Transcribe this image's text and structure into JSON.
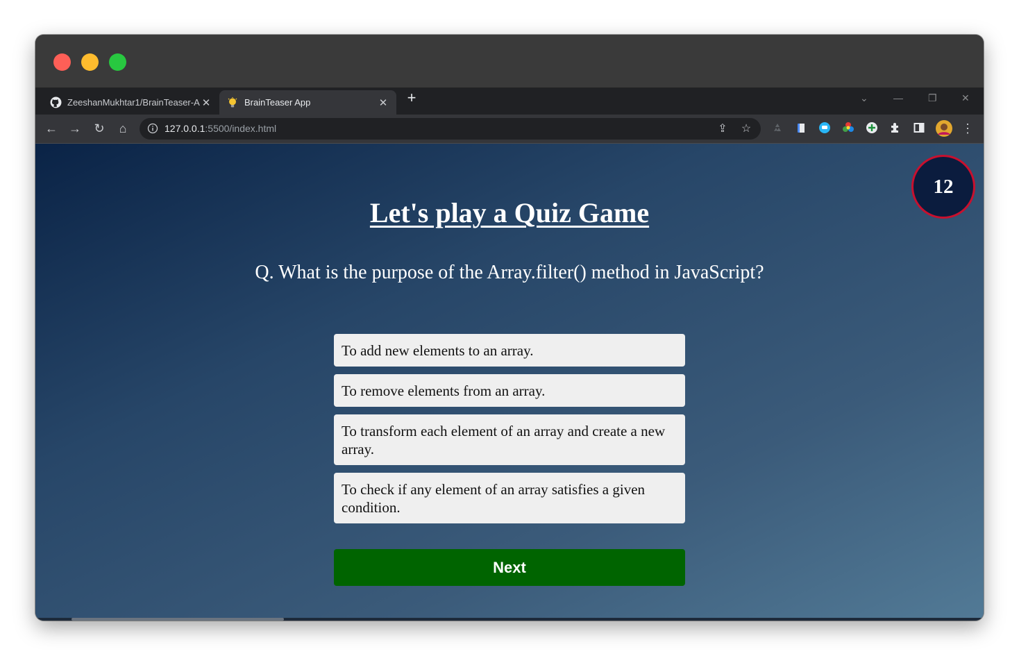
{
  "tabs": [
    {
      "title": "ZeeshanMukhtar1/BrainTeaser-A",
      "icon": "github-icon",
      "close": "✕"
    },
    {
      "title": "BrainTeaser App",
      "icon": "lightbulb-icon",
      "close": "✕"
    }
  ],
  "new_tab_label": "+",
  "address": {
    "host": "127.0.0.1",
    "path": ":5500/index.html"
  },
  "timer": "12",
  "heading": "Let's play a Quiz Game",
  "question": "Q. What is the purpose of the Array.filter() method in JavaScript?",
  "options": [
    "To add new elements to an array.",
    "To remove elements from an array.",
    "To transform each element of an array and create a new array.",
    "To check if any element of an array satisfies a given condition."
  ],
  "next_label": "Next",
  "colors": {
    "accent_green": "#006400",
    "timer_border": "#c8102e",
    "timer_bg": "#0b1c3e"
  }
}
